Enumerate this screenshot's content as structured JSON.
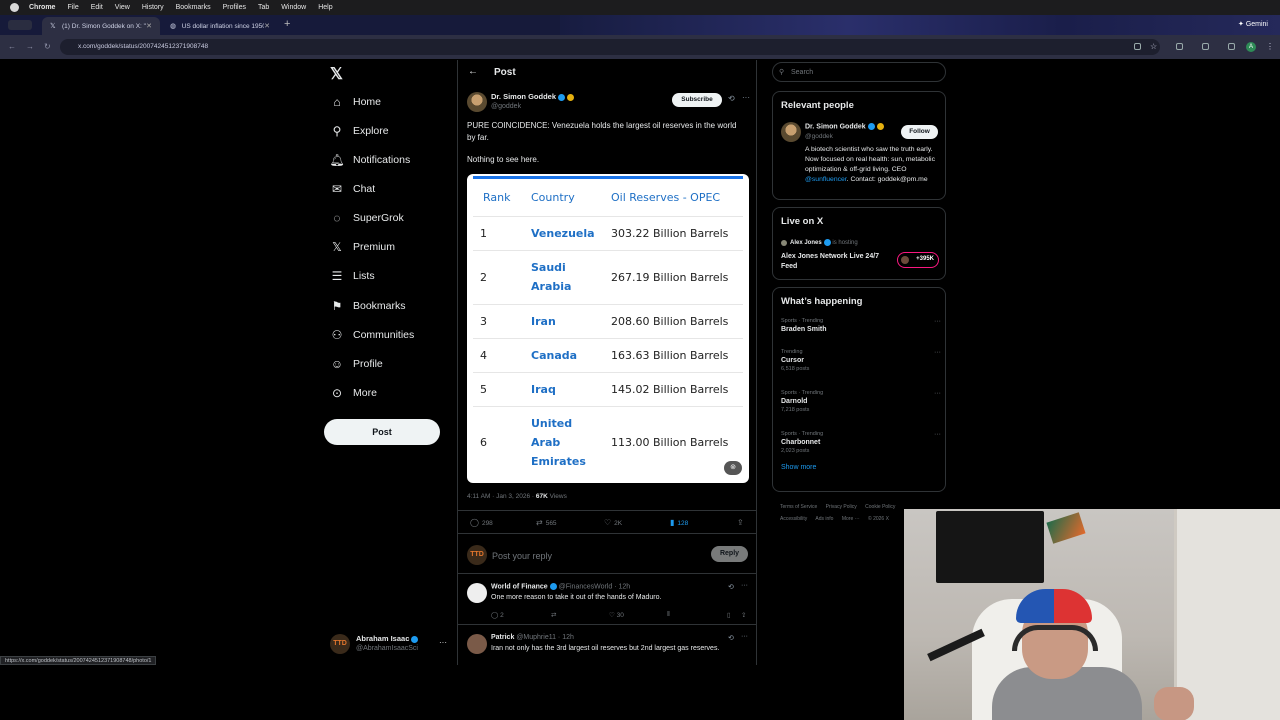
{
  "os_menu": {
    "items": [
      "Chrome",
      "File",
      "Edit",
      "View",
      "History",
      "Bookmarks",
      "Profiles",
      "Tab",
      "Window",
      "Help"
    ]
  },
  "browser": {
    "tabs": [
      {
        "title": "(1) Dr. Simon Goddek on X: \"P",
        "icon": "x-logo-icon"
      },
      {
        "title": "US dollar inflation since 1950",
        "icon": "globe-icon"
      }
    ],
    "url": "x.com/goddek/status/2007424512371908748",
    "gemini_label": "Gemini",
    "account_initial": "A",
    "status_url": "https://x.com/goddek/status/2007424512371908748/photo/1"
  },
  "nav": {
    "items": [
      {
        "label": "Home",
        "icon": "home-icon"
      },
      {
        "label": "Explore",
        "icon": "search-icon"
      },
      {
        "label": "Notifications",
        "icon": "bell-icon"
      },
      {
        "label": "Chat",
        "icon": "mail-icon"
      },
      {
        "label": "SuperGrok",
        "icon": "grok-icon"
      },
      {
        "label": "Premium",
        "icon": "x-logo-icon"
      },
      {
        "label": "Lists",
        "icon": "list-icon"
      },
      {
        "label": "Bookmarks",
        "icon": "bookmark-icon"
      },
      {
        "label": "Communities",
        "icon": "people-icon"
      },
      {
        "label": "Profile",
        "icon": "person-icon"
      },
      {
        "label": "More",
        "icon": "more-circle-icon"
      }
    ],
    "post_label": "Post",
    "me": {
      "name": "Abraham Isaac",
      "handle": "@AbrahamIsaacSci",
      "avatar_text": "TTD"
    }
  },
  "post": {
    "header_title": "Post",
    "author_name": "Dr. Simon Goddek",
    "author_handle": "@goddek",
    "subscribe_label": "Subscribe",
    "text1": "PURE COINCIDENCE: Venezuela holds the largest oil reserves in the world by far.",
    "text2": "Nothing to see here.",
    "table": {
      "headers": [
        "Rank",
        "Country",
        "Oil Reserves - OPEC"
      ],
      "rows": [
        [
          "1",
          "Venezuela",
          "303.22 Billion Barrels"
        ],
        [
          "2",
          "Saudi Arabia",
          "267.19 Billion Barrels"
        ],
        [
          "3",
          "Iran",
          "208.60 Billion Barrels"
        ],
        [
          "4",
          "Canada",
          "163.63 Billion Barrels"
        ],
        [
          "5",
          "Iraq",
          "145.02 Billion Barrels"
        ],
        [
          "6",
          "United Arab Emirates",
          "113.00 Billion Barrels"
        ]
      ]
    },
    "timestamp": "4:11 AM · Jan 3, 2026 · ",
    "views_count": "67K",
    "views_label": " Views",
    "replies": "298",
    "reposts": "565",
    "likes": "2K",
    "bookmarks": "128",
    "reply_placeholder": "Post your reply",
    "reply_button": "Reply"
  },
  "replies": [
    {
      "name": "World of Finance",
      "handle": "@FinancesWorld · 12h",
      "text": "One more reason to take it out of the hands of Maduro.",
      "replies": "2",
      "likes": "30"
    },
    {
      "name": "Patrick",
      "handle": "@Muphrie11 · 12h",
      "text": "Iran not only has the 3rd largest oil reserves but 2nd largest gas reserves.",
      "replies": "",
      "likes": ""
    }
  ],
  "right": {
    "search_placeholder": "Search",
    "relevant_title": "Relevant people",
    "person": {
      "name": "Dr. Simon Goddek",
      "handle": "@goddek",
      "follow_label": "Follow",
      "bio_pre": "A biotech scientist who saw the truth early. Now focused on real health: sun, metabolic optimization & off-grid living. CEO ",
      "bio_link": "@sunfluencer",
      "bio_post": ". Contact: goddek@pm.me"
    },
    "live_title": "Live on X",
    "live_host_name": "Alex Jones",
    "live_hosting": " is hosting",
    "live_stream_title": "Alex Jones Network Live 24/7 Feed",
    "live_count": "+395K",
    "happening_title": "What’s happening",
    "trends": [
      {
        "category": "Sports · Trending",
        "name": "Braden Smith",
        "posts": ""
      },
      {
        "category": "Trending",
        "name": "Cursor",
        "posts": "6,518 posts"
      },
      {
        "category": "Sports · Trending",
        "name": "Darnold",
        "posts": "7,218 posts"
      },
      {
        "category": "Sports · Trending",
        "name": "Charbonnet",
        "posts": "2,023 posts"
      }
    ],
    "show_more": "Show more",
    "footer": [
      "Terms of Service",
      "Privacy Policy",
      "Cookie Policy",
      "Accessibility",
      "Ads info",
      "More ···",
      "© 2026 X"
    ]
  }
}
